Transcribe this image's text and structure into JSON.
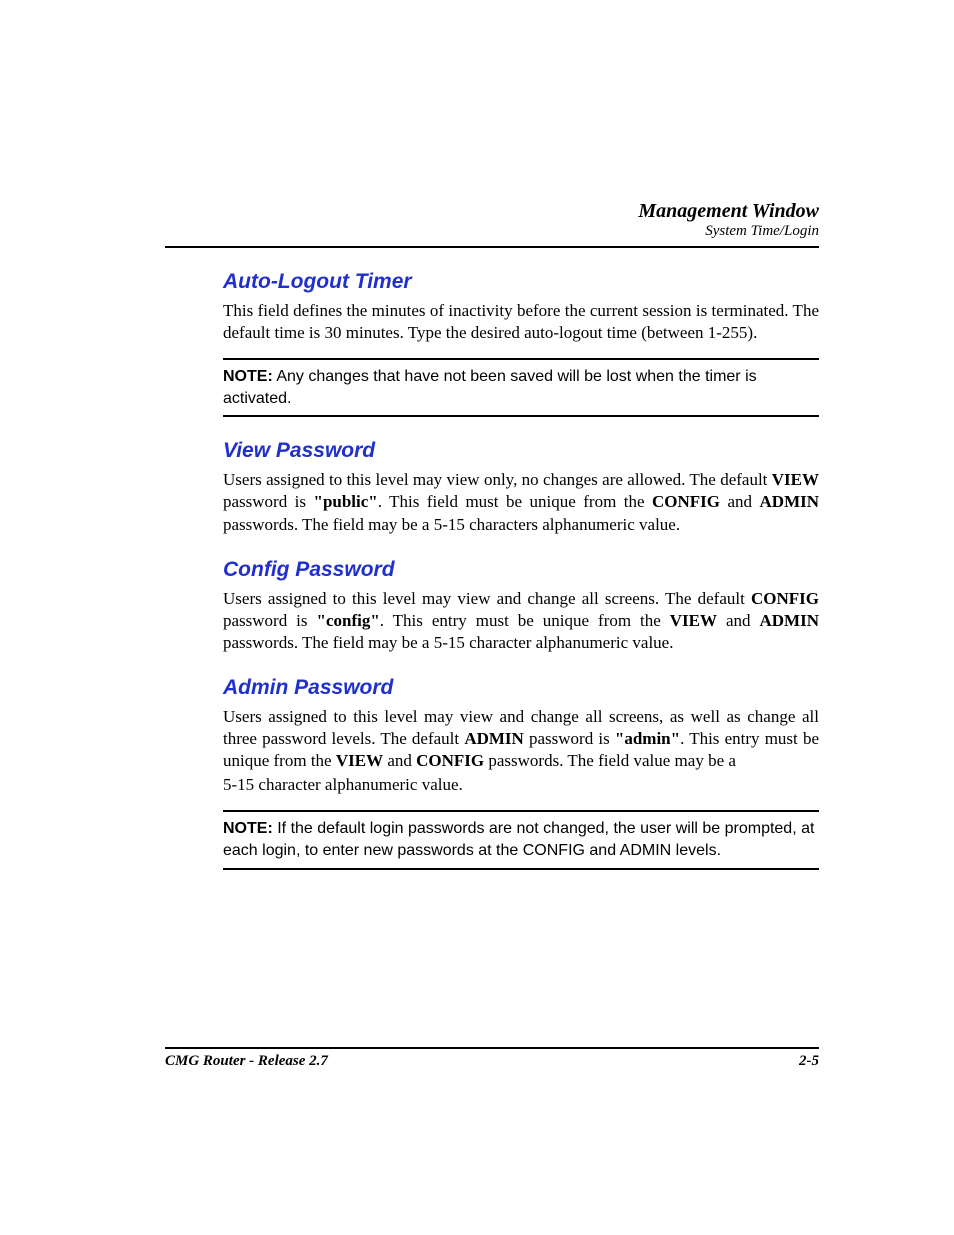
{
  "header": {
    "title": "Management Window",
    "subtitle": "System Time/Login"
  },
  "sections": {
    "auto_logout": {
      "title": "Auto-Logout Timer",
      "p1a": "This field defines the minutes of inactivity before the current session is terminated. The default time is 30 minutes. Type the desired auto-logout time (between 1-255).",
      "note_label": "NOTE:",
      "note_text": "  Any changes that have not been saved will be lost when the timer is activated."
    },
    "view_pw": {
      "title": "View Password",
      "t1": "Users assigned to this level may view only, no changes are allowed. The default ",
      "b1": "VIEW",
      "t2": " password is ",
      "b2": "\"public\"",
      "t3": ". This field must be unique from the ",
      "b3": "CONFIG",
      "t4": " and ",
      "b4": "ADMIN",
      "t5": " passwords. The field may be a 5-15 characters alphanumeric value."
    },
    "config_pw": {
      "title": "Config Password",
      "t1": "Users assigned to this level may view and change all screens. The default ",
      "b1": "CONFIG",
      "t2": " password is ",
      "b2": "\"config\"",
      "t3": ". This entry must be unique from the ",
      "b3": "VIEW",
      "t4": " and ",
      "b4": "ADMIN",
      "t5": " passwords. The field may be a 5-15 character alphanumeric value."
    },
    "admin_pw": {
      "title": "Admin Password",
      "t1": "Users assigned to this level may view and change all screens, as well as change all three password levels. The default ",
      "b1": "ADMIN",
      "t2": " password is ",
      "b2": "\"admin\"",
      "t3": ". This entry must be unique from the ",
      "b3": "VIEW",
      "t4": " and ",
      "b4": "CONFIG",
      "t5": " passwords. The field value may be a ",
      "t6": "5-15 character alphanumeric value.",
      "note_label": "NOTE:",
      "note_text": "  If the default login passwords are not changed, the user will be prompted, at each login, to enter new passwords at the CONFIG and ADMIN levels."
    }
  },
  "footer": {
    "left": "CMG Router - Release 2.7",
    "right": "2-5"
  }
}
